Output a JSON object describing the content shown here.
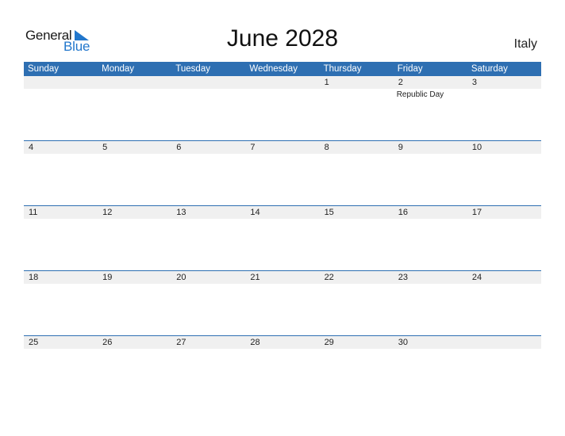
{
  "logo": {
    "word1": "General",
    "word2": "Blue"
  },
  "title": "June 2028",
  "country": "Italy",
  "colors": {
    "accent": "#2e6fb2",
    "day_row_bg": "#f0f0f0",
    "logo_blue": "#2277cc"
  },
  "weekdays": [
    "Sunday",
    "Monday",
    "Tuesday",
    "Wednesday",
    "Thursday",
    "Friday",
    "Saturday"
  ],
  "weeks": [
    {
      "days": [
        "",
        "",
        "",
        "",
        "1",
        "2",
        "3"
      ],
      "events": [
        "",
        "",
        "",
        "",
        "",
        "Republic Day",
        ""
      ]
    },
    {
      "days": [
        "4",
        "5",
        "6",
        "7",
        "8",
        "9",
        "10"
      ],
      "events": [
        "",
        "",
        "",
        "",
        "",
        "",
        ""
      ]
    },
    {
      "days": [
        "11",
        "12",
        "13",
        "14",
        "15",
        "16",
        "17"
      ],
      "events": [
        "",
        "",
        "",
        "",
        "",
        "",
        ""
      ]
    },
    {
      "days": [
        "18",
        "19",
        "20",
        "21",
        "22",
        "23",
        "24"
      ],
      "events": [
        "",
        "",
        "",
        "",
        "",
        "",
        ""
      ]
    },
    {
      "days": [
        "25",
        "26",
        "27",
        "28",
        "29",
        "30",
        ""
      ],
      "events": [
        "",
        "",
        "",
        "",
        "",
        "",
        ""
      ]
    }
  ]
}
